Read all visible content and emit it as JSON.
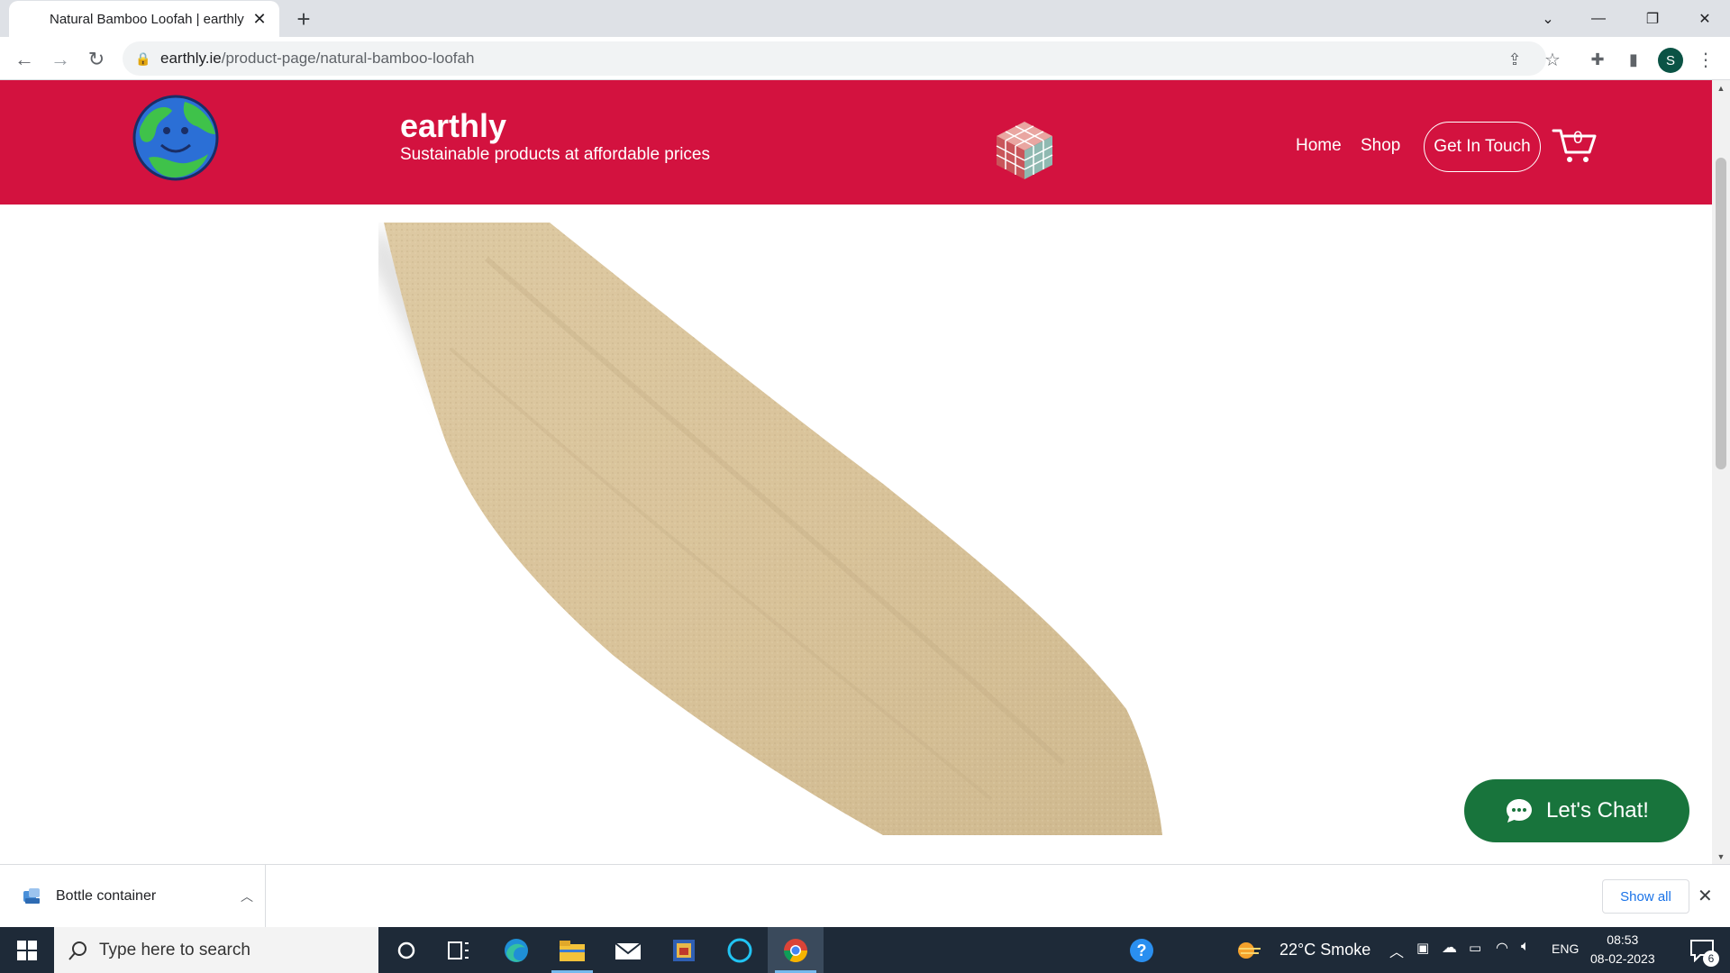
{
  "browser": {
    "tab_title": "Natural Bamboo Loofah | earthly",
    "url_domain": "earthly.ie",
    "url_path": "/product-page/natural-bamboo-loofah",
    "profile_initial": "S"
  },
  "site": {
    "brand_name": "earthly",
    "tagline": "Sustainable products at affordable prices",
    "nav": [
      "Home",
      "Shop"
    ],
    "cta_label": "Get In Touch",
    "cart_count": "0",
    "colors": {
      "header": "#d3123f",
      "chat": "#18743c"
    }
  },
  "chat": {
    "label": "Let's Chat!"
  },
  "downloads": {
    "item_name": "Bottle container",
    "show_all_label": "Show all"
  },
  "taskbar": {
    "search_placeholder": "Type here to search",
    "weather": "22°C  Smoke",
    "language": "ENG",
    "time": "08:53",
    "date": "08-02-2023",
    "notification_count": "6"
  }
}
